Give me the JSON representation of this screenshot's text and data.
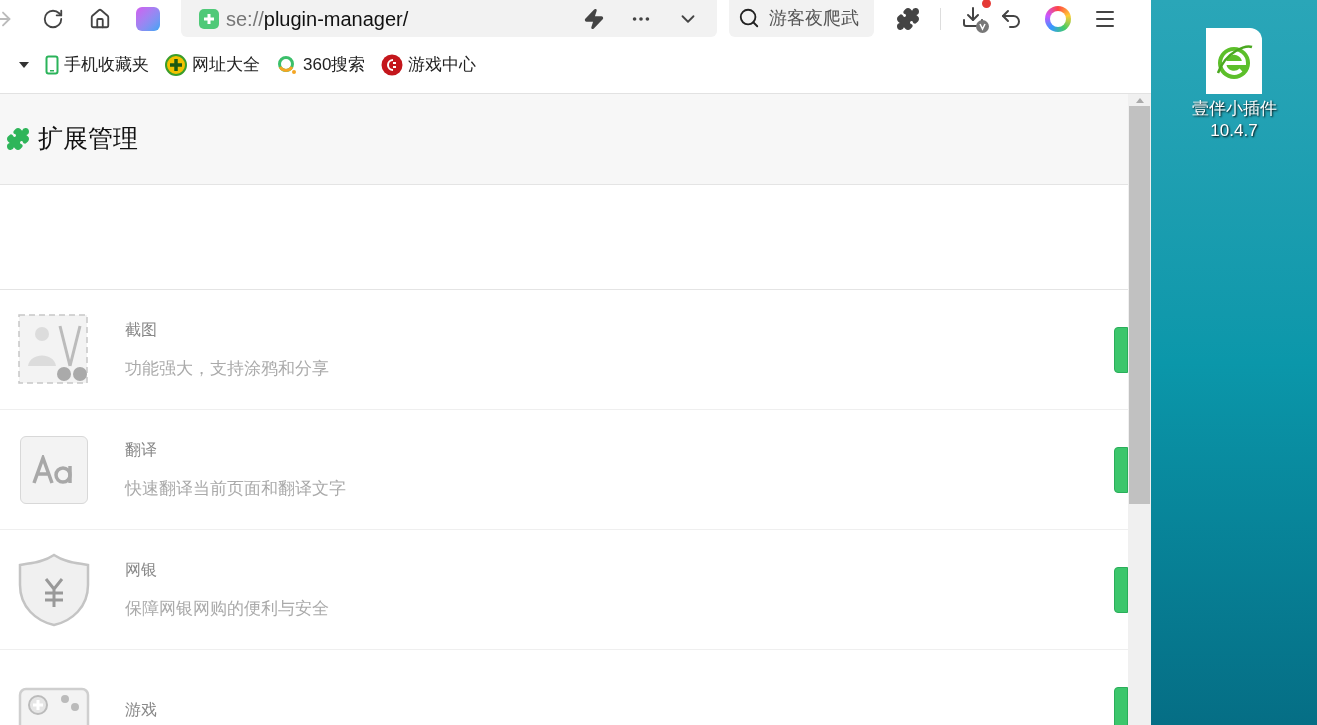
{
  "toolbar": {
    "url_scheme": "se://",
    "url_path": "plugin-manager/",
    "search": {
      "placeholder": "游客夜爬武"
    },
    "download_badge": true
  },
  "bookmarks": [
    {
      "kind": "phone",
      "label": "手机收藏夹"
    },
    {
      "kind": "plus",
      "label": "网址大全"
    },
    {
      "kind": "ring",
      "label": "360搜索"
    },
    {
      "kind": "game",
      "label": "游戏中心"
    }
  ],
  "page": {
    "title": "扩展管理"
  },
  "extensions": [
    {
      "kind": "screenshot",
      "name": "截图",
      "description": "功能强大，支持涂鸦和分享",
      "on": true
    },
    {
      "kind": "translate",
      "name": "翻译",
      "description": "快速翻译当前页面和翻译文字",
      "on": true
    },
    {
      "kind": "bank",
      "name": "网银",
      "description": "保障网银网购的便利与安全",
      "on": true
    },
    {
      "kind": "game",
      "name": "游戏",
      "on": true
    }
  ],
  "desktop": {
    "icon_label": "壹伴小插件",
    "icon_version": "10.4.7"
  }
}
